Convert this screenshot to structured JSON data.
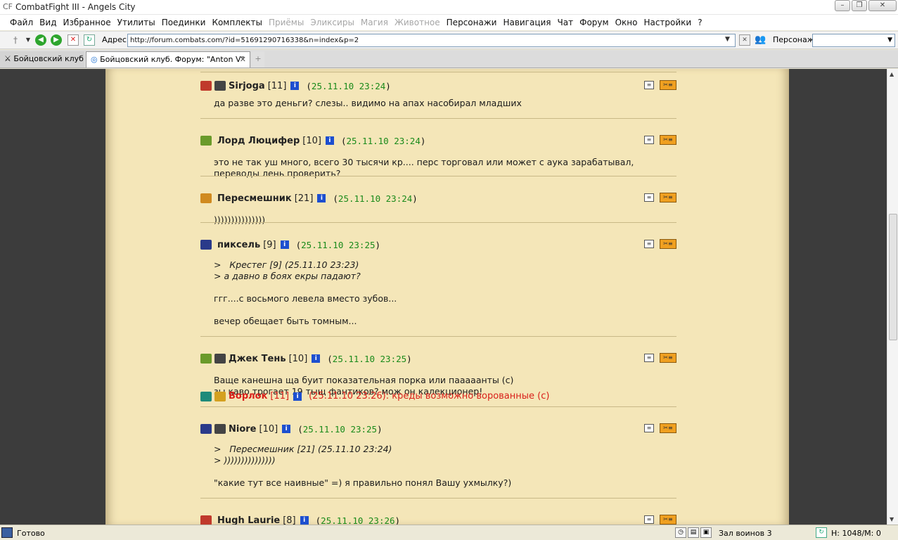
{
  "window": {
    "title": "CombatFight III - Angels City",
    "app_icon": "CF"
  },
  "menu": [
    {
      "label": "Файл",
      "enabled": true
    },
    {
      "label": "Вид",
      "enabled": true
    },
    {
      "label": "Избранное",
      "enabled": true
    },
    {
      "label": "Утилиты",
      "enabled": true
    },
    {
      "label": "Поединки",
      "enabled": true
    },
    {
      "label": "Комплекты",
      "enabled": true
    },
    {
      "label": "Приёмы",
      "enabled": false
    },
    {
      "label": "Эликсиры",
      "enabled": false
    },
    {
      "label": "Магия",
      "enabled": false
    },
    {
      "label": "Животное",
      "enabled": false
    },
    {
      "label": "Персонажи",
      "enabled": true
    },
    {
      "label": "Навигация",
      "enabled": true
    },
    {
      "label": "Чат",
      "enabled": true
    },
    {
      "label": "Форум",
      "enabled": true
    },
    {
      "label": "Окно",
      "enabled": true
    },
    {
      "label": "Настройки",
      "enabled": true
    },
    {
      "label": "?",
      "enabled": true
    }
  ],
  "address": {
    "label": "Адрес:",
    "url": "http://forum.combats.com/?id=51691290716338&n=index&p=2",
    "character_label": "Персонаж:"
  },
  "tabs": [
    {
      "label": "Бойцовский клуб",
      "active": false
    },
    {
      "label": "Бойцовский клуб. Форум: \"Anton V\"",
      "active": true
    }
  ],
  "posts": [
    {
      "nick": "Sirjoga",
      "level": "[11]",
      "date": "25.11.10 23:24",
      "align_color": "#c0392b",
      "clan": true,
      "lines": [
        "да разве это деньги? слезы.. видимо на апах насобирал младших"
      ]
    },
    {
      "nick": "Лорд Люцифер",
      "level": "[10]",
      "date": "25.11.10 23:24",
      "align_color": "#6a9a2a",
      "clan": false,
      "lines": [
        "это не так уш много, всего 30 тысячи кр.... перс торговал или может с аука зарабатывал,",
        "переводы лень проверить?"
      ]
    },
    {
      "nick": "Пересмешник",
      "level": "[21]",
      "date": "25.11.10 23:24",
      "align_color": "#d08a20",
      "clan": false,
      "lines": [
        ")))))))))))))))"
      ]
    },
    {
      "nick": "пиксель",
      "level": "[9]",
      "date": "25.11.10 23:25",
      "align_color": "#2a3a8a",
      "clan": false,
      "quote": [
        ">   Крестег [9] (25.11.10 23:23)",
        "> а давно в боях екры падают?"
      ],
      "lines": [
        "ггг....с восьмого левела вместо зубов...",
        "",
        "вечер обещает быть томным..."
      ]
    },
    {
      "nick": "Джек Тень",
      "level": "[10]",
      "date": "25.11.10 23:25",
      "align_color": "#6a9a2a",
      "clan": true,
      "lines": [
        "Ваще канешна ща буит показательная порка или пааааанты (с)",
        "зы каво трогает 19 тыщ фантиков? мож он калекционер!"
      ]
    },
    {
      "nick": "Niore",
      "level": "[10]",
      "date": "25.11.10 23:25",
      "align_color": "#2a3a8a",
      "clan": true,
      "quote": [
        ">   Пересмешник [21] (25.11.10 23:24)",
        "> )))))))))))))))"
      ],
      "lines": [
        "\"какие тут все наивные\" =) я правильно понял Вашу ухмылку?)"
      ]
    },
    {
      "nick": "Hugh Laurie",
      "level": "[8]",
      "date": "25.11.10 23:26",
      "align_color": "#c0392b",
      "clan": false,
      "lines": []
    }
  ],
  "reply": {
    "nick": "Ворлок",
    "level": "[11]",
    "text": "(25.11.10 23:26): креды возможно ворованные (с)"
  },
  "status": {
    "text": "Готово",
    "room": "Зал воинов 3",
    "hm": "Н: 1048/М: 0"
  }
}
